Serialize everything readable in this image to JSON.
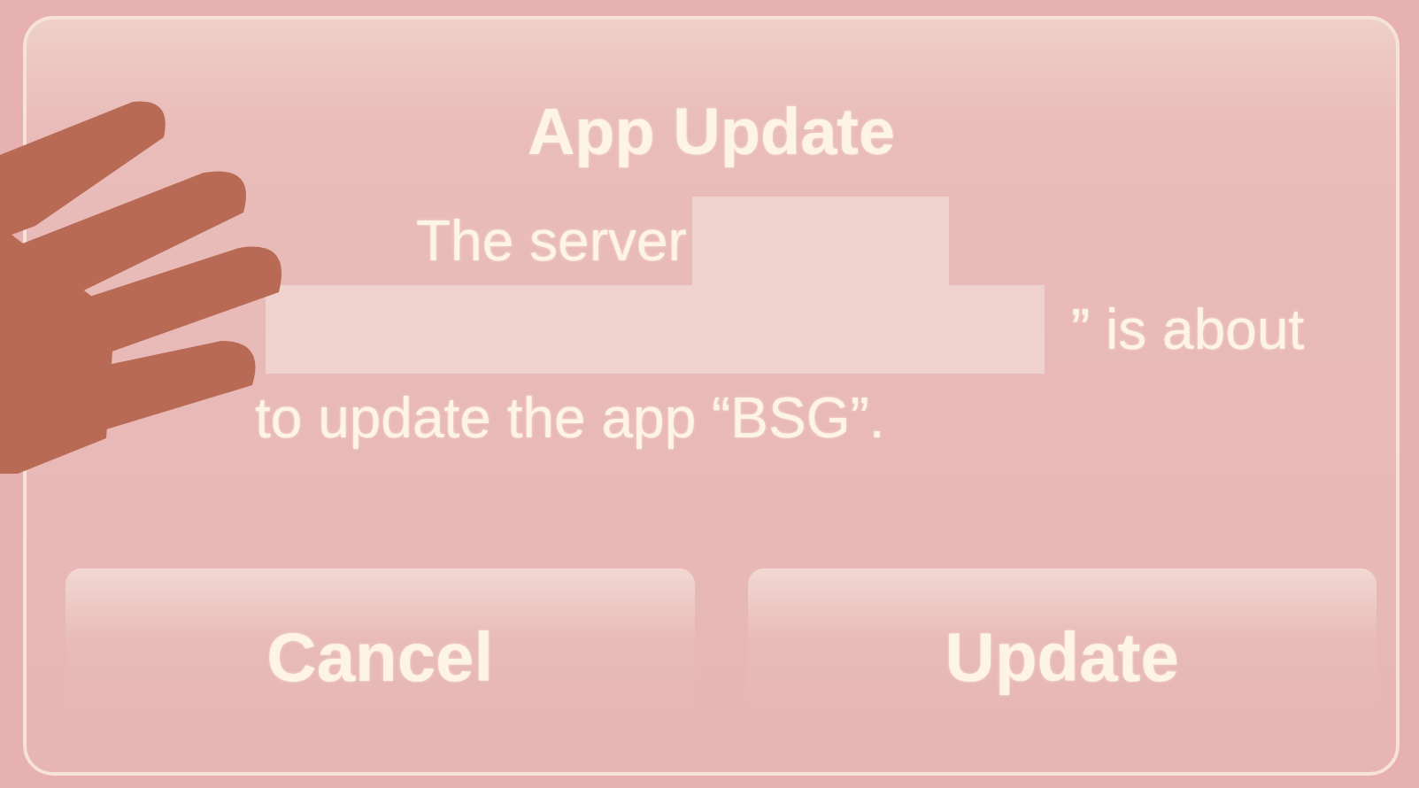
{
  "dialog": {
    "title": "App Update",
    "message_lines": [
      "The server",
      "” is about",
      "to update the app “BSG”."
    ],
    "buttons": [
      {
        "label": "Cancel"
      },
      {
        "label": "Update"
      }
    ]
  }
}
